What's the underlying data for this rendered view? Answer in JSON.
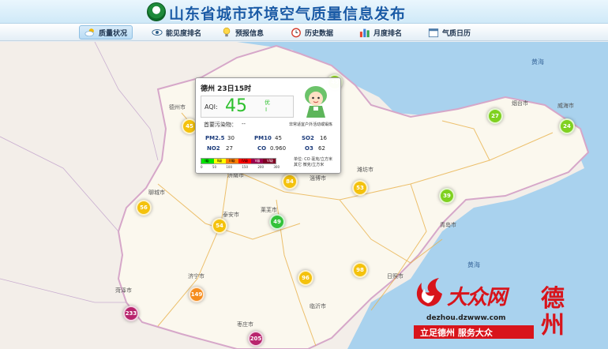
{
  "header": {
    "title": "山东省城市环境空气质量信息发布"
  },
  "nav": {
    "items": [
      {
        "label": "质量状况",
        "icon": "cloud-sun-icon",
        "active": true
      },
      {
        "label": "能见度排名",
        "icon": "eye-icon",
        "active": false
      },
      {
        "label": "预报信息",
        "icon": "lightbulb-icon",
        "active": false
      },
      {
        "label": "历史数据",
        "icon": "clock-icon",
        "active": false
      },
      {
        "label": "月度排名",
        "icon": "bar-chart-icon",
        "active": false
      },
      {
        "label": "气质日历",
        "icon": "calendar-icon",
        "active": false
      }
    ]
  },
  "map": {
    "sea_labels": [
      "黄海",
      "黄海"
    ],
    "city_labels": [
      "德州市",
      "聊城市",
      "济南市",
      "淄博市",
      "潍坊市",
      "烟台市",
      "威海市",
      "泰安市",
      "莱芜市",
      "济宁市",
      "菏泽市",
      "枣庄市",
      "临沂市",
      "日照市",
      "青岛市"
    ],
    "markers": [
      {
        "value": "45",
        "color": "#f4c20d"
      },
      {
        "value": "45",
        "color": "#8fd11f"
      },
      {
        "value": "56",
        "color": "#f4c20d"
      },
      {
        "value": "84",
        "color": "#f4c20d"
      },
      {
        "value": "53",
        "color": "#f4c20d"
      },
      {
        "value": "54",
        "color": "#f4c20d"
      },
      {
        "value": "49",
        "color": "#33c23a"
      },
      {
        "value": "39",
        "color": "#7fd11f"
      },
      {
        "value": "27",
        "color": "#7fd11f"
      },
      {
        "value": "24",
        "color": "#7fd11f"
      },
      {
        "value": "96",
        "color": "#f4c20d"
      },
      {
        "value": "98",
        "color": "#f4c20d"
      },
      {
        "value": "149",
        "color": "#f58d1e"
      },
      {
        "value": "233",
        "color": "#b8246d"
      },
      {
        "value": "205",
        "color": "#b8246d"
      }
    ]
  },
  "popup": {
    "city_time": "德州 23日15时",
    "aqi_label": "AQI:",
    "aqi_value": "45",
    "level": "优",
    "grade": "I",
    "primary_pollutant_label": "首要污染物：",
    "primary_pollutant_value": "--",
    "advice": "非常适宜户外活动或锻炼",
    "metrics": [
      {
        "name": "PM2.5",
        "value": "30"
      },
      {
        "name": "PM10",
        "value": "45"
      },
      {
        "name": "SO2",
        "value": "16"
      },
      {
        "name": "NO2",
        "value": "27"
      },
      {
        "name": "CO",
        "value": "0.960"
      },
      {
        "name": "O3",
        "value": "62"
      }
    ],
    "scale_grades": [
      "I级",
      "II级",
      "III级",
      "IV级",
      "V级",
      "VI级"
    ],
    "scale_numbers": [
      "0",
      "50",
      "100",
      "150",
      "200",
      "300"
    ],
    "scale_colors": [
      "#00e400",
      "#ffff00",
      "#ff7e00",
      "#ff0000",
      "#99004c",
      "#7e0023"
    ],
    "unit_line1": "单位: CO 毫克/立方米",
    "unit_line2": "其它 微克/立方米"
  },
  "watermark": {
    "brand": "大众网",
    "domain": "dezhou.dzwww.com",
    "slogan": "立足德州  服务大众",
    "city": "德州",
    "brand_color": "#d8141b"
  }
}
